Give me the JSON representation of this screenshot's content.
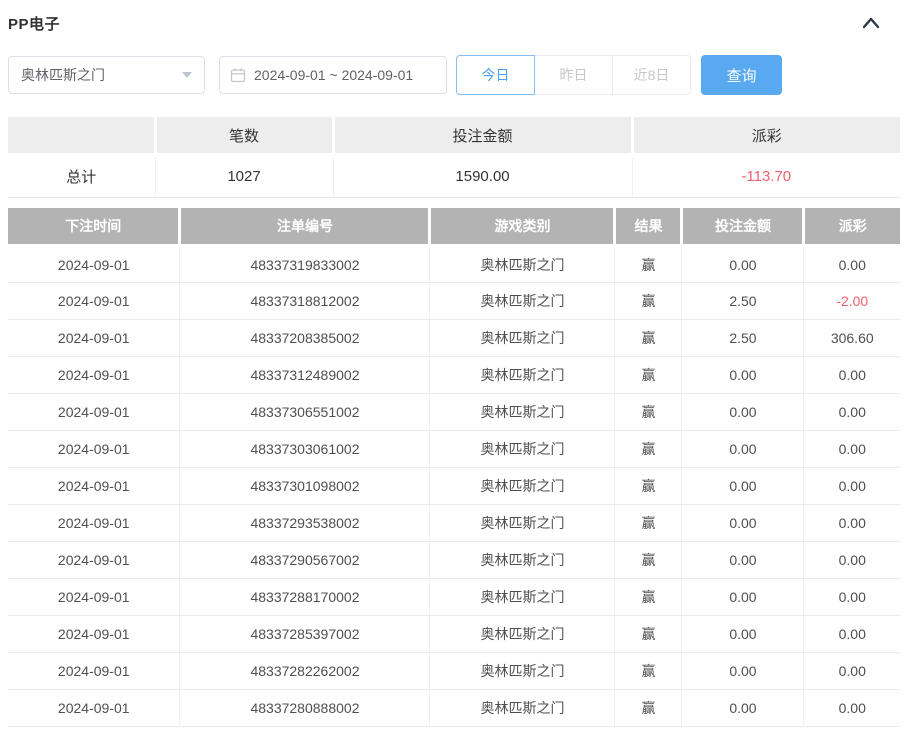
{
  "panel": {
    "title": "PP电子"
  },
  "filters": {
    "game_select": {
      "value": "奥林匹斯之门"
    },
    "date_range": {
      "value": "2024-09-01 ~ 2024-09-01"
    },
    "quick_buttons": [
      {
        "label": "今日",
        "active": true
      },
      {
        "label": "昨日",
        "active": false
      },
      {
        "label": "近8日",
        "active": false
      }
    ],
    "search_label": "查询"
  },
  "summary": {
    "headers": [
      "",
      "笔数",
      "投注金额",
      "派彩"
    ],
    "total_label": "总计",
    "count": "1027",
    "bet_amount": "1590.00",
    "payout": "-113.70"
  },
  "detail_table": {
    "headers": [
      "下注时间",
      "注单编号",
      "游戏类别",
      "结果",
      "投注金额",
      "派彩"
    ],
    "rows": [
      [
        "2024-09-01",
        "48337319833002",
        "奥林匹斯之门",
        "赢",
        "0.00",
        "0.00"
      ],
      [
        "2024-09-01",
        "48337318812002",
        "奥林匹斯之门",
        "赢",
        "2.50",
        "-2.00"
      ],
      [
        "2024-09-01",
        "48337208385002",
        "奥林匹斯之门",
        "赢",
        "2.50",
        "306.60"
      ],
      [
        "2024-09-01",
        "48337312489002",
        "奥林匹斯之门",
        "赢",
        "0.00",
        "0.00"
      ],
      [
        "2024-09-01",
        "48337306551002",
        "奥林匹斯之门",
        "赢",
        "0.00",
        "0.00"
      ],
      [
        "2024-09-01",
        "48337303061002",
        "奥林匹斯之门",
        "赢",
        "0.00",
        "0.00"
      ],
      [
        "2024-09-01",
        "48337301098002",
        "奥林匹斯之门",
        "赢",
        "0.00",
        "0.00"
      ],
      [
        "2024-09-01",
        "48337293538002",
        "奥林匹斯之门",
        "赢",
        "0.00",
        "0.00"
      ],
      [
        "2024-09-01",
        "48337290567002",
        "奥林匹斯之门",
        "赢",
        "0.00",
        "0.00"
      ],
      [
        "2024-09-01",
        "48337288170002",
        "奥林匹斯之门",
        "赢",
        "0.00",
        "0.00"
      ],
      [
        "2024-09-01",
        "48337285397002",
        "奥林匹斯之门",
        "赢",
        "0.00",
        "0.00"
      ],
      [
        "2024-09-01",
        "48337282262002",
        "奥林匹斯之门",
        "赢",
        "0.00",
        "0.00"
      ],
      [
        "2024-09-01",
        "48337280888002",
        "奥林匹斯之门",
        "赢",
        "0.00",
        "0.00"
      ]
    ]
  },
  "colors": {
    "accent": "#59a9f1",
    "active_segment": "#4d9ef1",
    "negative": "#f25f6d",
    "detail_header_bg": "#b3b3b3",
    "summary_header_bg": "#ededed"
  }
}
